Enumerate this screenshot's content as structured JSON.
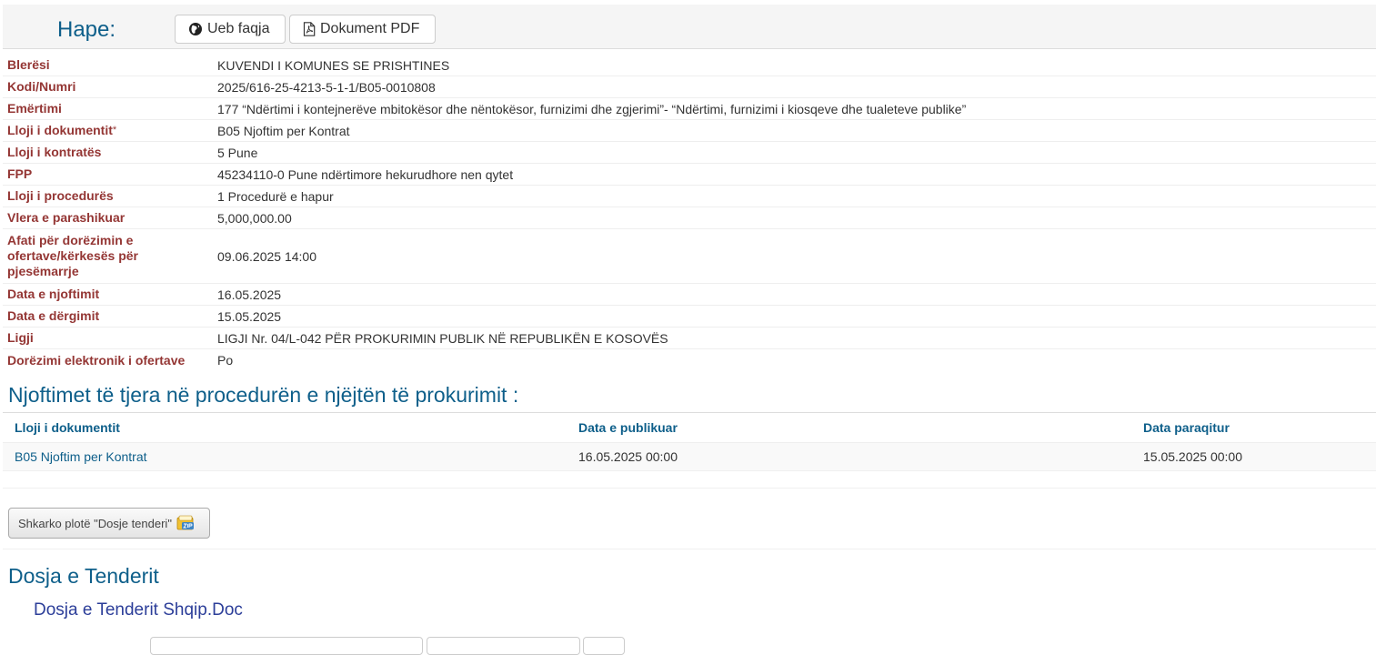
{
  "toolbar": {
    "open_label": "Hape:",
    "web_button": "Ueb faqja",
    "pdf_button": "Dokument PDF"
  },
  "details": [
    {
      "label": "Blerësi",
      "value": "KUVENDI I KOMUNES SE PRISHTINES"
    },
    {
      "label": "Kodi/Numri",
      "value": "2025/616-25-4213-5-1-1/B05-0010808"
    },
    {
      "label": "Emërtimi",
      "value": "177 “Ndërtimi i kontejnerëve mbitokësor dhe nëntokësor, furnizimi dhe zgjerimi”- “Ndërtimi, furnizimi i kiosqeve dhe tualeteve publike”"
    },
    {
      "label": "Lloji i dokumentit",
      "value": "B05 Njoftim per Kontrat",
      "marker": "*"
    },
    {
      "label": "Lloji i kontratës",
      "value": "5 Pune"
    },
    {
      "label": "FPP",
      "value": "45234110-0 Pune ndërtimore hekurudhore nen qytet"
    },
    {
      "label": "Lloji i procedurës",
      "value": "1 Procedurë e hapur"
    },
    {
      "label": "Vlera e parashikuar",
      "value": "5,000,000.00"
    },
    {
      "label": "Afati për dorëzimin e ofertave/kërkesës për pjesëmarrje",
      "value": "09.06.2025 14:00"
    },
    {
      "label": "Data e njoftimit",
      "value": "16.05.2025"
    },
    {
      "label": "Data e dërgimit",
      "value": "15.05.2025"
    },
    {
      "label": "Ligji",
      "value": "LIGJI Nr. 04/L-042 PËR PROKURIMIN PUBLIK NË REPUBLIKËN E KOSOVËS"
    },
    {
      "label": "Dorëzimi elektronik i ofertave",
      "value": "Po"
    }
  ],
  "notices": {
    "title": "Njoftimet të tjera në procedurën e njëjtën të prokurimit :",
    "columns": [
      "Lloji i dokumentit",
      "Data e publikuar",
      "Data paraqitur"
    ],
    "rows": [
      [
        "B05 Njoftim per Kontrat",
        "16.05.2025 00:00",
        "15.05.2025 00:00"
      ]
    ]
  },
  "download": {
    "label": "Shkarko plotë \"Dosje tenderi\""
  },
  "tender": {
    "title": "Dosja e Tenderit",
    "document": "Dosja e Tenderit Shqip.Doc"
  },
  "colors": {
    "heading": "#0e5f8a",
    "label": "#943634",
    "doc_link": "#2c3e99"
  }
}
